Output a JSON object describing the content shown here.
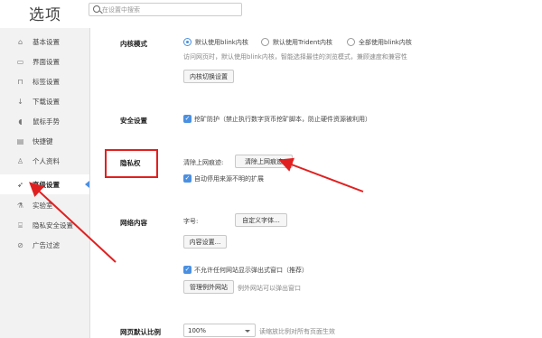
{
  "header": {
    "title": "选项",
    "search_placeholder": "在设置中搜索"
  },
  "sidebar": {
    "items": [
      {
        "label": "基本设置",
        "icon": "home-icon"
      },
      {
        "label": "界面设置",
        "icon": "layout-icon"
      },
      {
        "label": "标签设置",
        "icon": "tab-icon"
      },
      {
        "label": "下载设置",
        "icon": "download-icon"
      },
      {
        "label": "鼠标手势",
        "icon": "mouse-icon"
      },
      {
        "label": "快捷键",
        "icon": "keyboard-icon"
      },
      {
        "label": "个人资料",
        "icon": "user-icon"
      },
      {
        "label": "高级设置",
        "icon": "rocket-icon",
        "active": true
      },
      {
        "label": "实验室",
        "icon": "lab-icon"
      },
      {
        "label": "隐私安全设置",
        "icon": "lock-icon"
      },
      {
        "label": "广告过滤",
        "icon": "block-icon"
      }
    ]
  },
  "kernel": {
    "label": "内核模式",
    "options": [
      "默认使用blink内核",
      "默认使用Trident内核",
      "全部使用blink内核"
    ],
    "selected": "默认使用blink内核",
    "description": "访问网页时，默认使用blink内核，智能选择最佳的浏览模式，兼顾速度和兼容性",
    "switch_button": "内核切换设置"
  },
  "security": {
    "label": "安全设置",
    "mining_protection": "挖矿防护（禁止执行数字货币挖矿脚本，防止硬件资源被利用）",
    "mining_checked": true
  },
  "privacy": {
    "label": "隐私权",
    "clear_label": "清除上网痕迹:",
    "clear_button": "清除上网痕迹",
    "disable_extensions": "自动停用来源不明的扩展",
    "disable_checked": true
  },
  "web_content": {
    "label": "网络内容",
    "font_label": "字号:",
    "custom_font_button": "自定义字体...",
    "content_settings_button": "内容设置...",
    "popup_block": "不允许任何网站显示弹出式窗口（推荐）",
    "popup_checked": true,
    "manage_exceptions_button": "管理例外网站",
    "exceptions_hint": "例外网站可以弹出窗口"
  },
  "zoom": {
    "label": "网页默认比例",
    "value": "100%",
    "hint": "读缩放比例对所有页面生效"
  },
  "colors": {
    "accent": "#4a90e2",
    "annotation": "#e02020"
  }
}
